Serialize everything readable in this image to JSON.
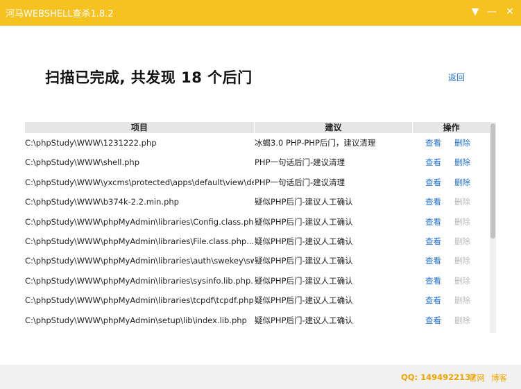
{
  "window": {
    "title": "河马WEBSHELL查杀1.8.2",
    "menu_glyph": "▼",
    "minimize_glyph": "—",
    "close_glyph": "✕"
  },
  "summary": {
    "prefix": "扫描已完成, 共发现 ",
    "count": "18",
    "suffix": " 个后门",
    "back_label": "返回"
  },
  "table": {
    "headers": {
      "item": "项目",
      "suggestion": "建议",
      "action": "操作"
    },
    "enabled_color": "#1f6fd1",
    "disabled_color": "#b9b9b9",
    "rows": [
      {
        "path": "C:\\phpStudy\\WWW\\1231222.php",
        "suggestion": "冰蝎3.0 PHP-PHP后门，建议清理",
        "view": "查看",
        "delete": "删除",
        "delete_enabled": true
      },
      {
        "path": "C:\\phpStudy\\WWW\\shell.php",
        "suggestion": "PHP一句话后门-建议清理",
        "view": "查看",
        "delete": "删除",
        "delete_enabled": true
      },
      {
        "path": "C:\\phpStudy\\WWW\\yxcms\\protected\\apps\\default\\view\\defau...",
        "suggestion": "PHP一句话后门-建议清理",
        "view": "查看",
        "delete": "删除",
        "delete_enabled": true
      },
      {
        "path": "C:\\phpStudy\\WWW\\b374k-2.2.min.php",
        "suggestion": "疑似PHP后门-建议人工确认",
        "view": "查看",
        "delete": "删除",
        "delete_enabled": false
      },
      {
        "path": "C:\\phpStudy\\WWW\\phpMyAdmin\\libraries\\Config.class.php...",
        "suggestion": "疑似PHP后门-建议人工确认",
        "view": "查看",
        "delete": "删除",
        "delete_enabled": false
      },
      {
        "path": "C:\\phpStudy\\WWW\\phpMyAdmin\\libraries\\File.class.php...",
        "suggestion": "疑似PHP后门-建议人工确认",
        "view": "查看",
        "delete": "删除",
        "delete_enabled": false
      },
      {
        "path": "C:\\phpStudy\\WWW\\phpMyAdmin\\libraries\\auth\\swekey\\swekey...",
        "suggestion": "疑似PHP后门-建议人工确认",
        "view": "查看",
        "delete": "删除",
        "delete_enabled": false
      },
      {
        "path": "C:\\phpStudy\\WWW\\phpMyAdmin\\libraries\\sysinfo.lib.php...",
        "suggestion": "疑似PHP后门-建议人工确认",
        "view": "查看",
        "delete": "删除",
        "delete_enabled": false
      },
      {
        "path": "C:\\phpStudy\\WWW\\phpMyAdmin\\libraries\\tcpdf\\tcpdf.php...",
        "suggestion": "疑似PHP后门-建议人工确认",
        "view": "查看",
        "delete": "删除",
        "delete_enabled": false
      },
      {
        "path": "C:\\phpStudy\\WWW\\phpMyAdmin\\setup\\lib\\index.lib.php",
        "suggestion": "疑似PHP后门-建议人工确认",
        "view": "查看",
        "delete": "删除",
        "delete_enabled": false
      }
    ]
  },
  "footer": {
    "qq": "QQ: 1494922137",
    "website": "官网",
    "blog": "博客"
  }
}
